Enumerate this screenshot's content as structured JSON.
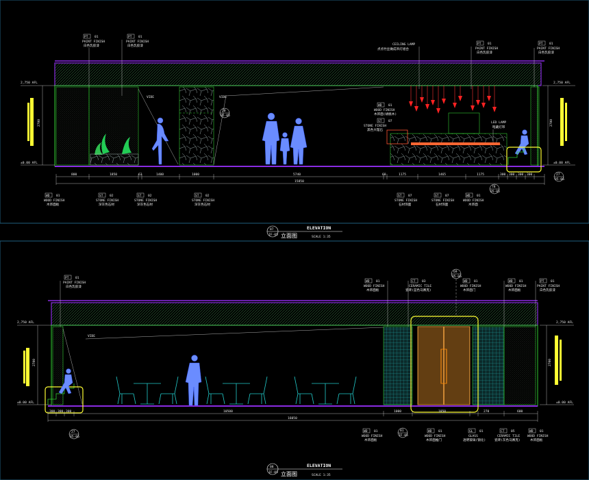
{
  "colors": {
    "background": "#000000",
    "ceiling_band": "#1a3a28",
    "purple_line": "#8a2be2",
    "green_line": "#33cc33",
    "cyan_line": "#22cccc",
    "yellow_line": "#ffff33",
    "red_lamp": "#ff2222",
    "human_figure": "#6699ff",
    "door_wood": "#cc8833"
  },
  "top": {
    "tags": {
      "pt_left1": {
        "code": "PT",
        "num": "01",
        "en": "PAINT FINISH",
        "cn": "白色乳胶漆"
      },
      "pt_left2": {
        "code": "PT",
        "num": "01",
        "en": "PAINT FINISH",
        "cn": "白色乳胶漆"
      },
      "ceiling_lamp": {
        "en": "CEILING LAMP",
        "cn": "点点竹丝做成吊灯组合"
      },
      "pt_right1": {
        "code": "PT",
        "num": "01",
        "en": "PAINT FINISH",
        "cn": "白色乳胶漆"
      },
      "pt_right2": {
        "code": "PT",
        "num": "01",
        "en": "PAINT FINISH",
        "cn": "白色乳胶漆"
      },
      "wd_mid": {
        "code": "WD",
        "num": "01",
        "en": "WOOD FINISH",
        "cn": "木饰面(胡桃木)"
      },
      "st_mid": {
        "code": "ST",
        "num": "07",
        "en": "STONE FINISH",
        "cn": "黑色大理石"
      },
      "led_lamp": {
        "en": "LED LAMP",
        "cn": "暗藏灯带"
      },
      "wd_bl": {
        "code": "WD",
        "num": "01",
        "en": "WOOD FINISH",
        "cn": "木饰面板"
      },
      "st_b1": {
        "code": "ST",
        "num": "02",
        "en": "STONE FINISH",
        "cn": "深灰色石材"
      },
      "st_b2": {
        "code": "ST",
        "num": "02",
        "en": "STONE FINISH",
        "cn": "深灰色石材"
      },
      "st_b3": {
        "code": "ST",
        "num": "02",
        "en": "STONE FINISH",
        "cn": "深灰色石材"
      },
      "st_br1": {
        "code": "ST",
        "num": "07",
        "en": "STONE FINISH",
        "cn": "石材饰面"
      },
      "st_br2": {
        "code": "ST",
        "num": "07",
        "en": "STONE FINISH",
        "cn": "石材饰面"
      },
      "wd_br3": {
        "code": "WD",
        "num": "01",
        "en": "WOOD FINISH",
        "cn": "木饰面"
      }
    },
    "void_label1": "VIDE",
    "void_label2": "VIDE",
    "bubble_20": {
      "num": "20",
      "ref": "05-05"
    },
    "bubble_78": {
      "num": "78",
      "ref": "05-05"
    },
    "bubble_27": {
      "num": "27",
      "ref": "05-06"
    },
    "levels": {
      "left_top": "2,750 AFL",
      "left_bot": "±0.00 AFL",
      "right_top": "2,750 AFL",
      "right_bot": "±0.00 AFL"
    },
    "height_left": "2700",
    "height_right": "2700",
    "dims": [
      "800",
      "1850",
      "63",
      "1400",
      "1000",
      "5740",
      "60",
      "1175",
      "1465",
      "1175",
      "300",
      "300",
      "300",
      "300"
    ],
    "total": "15850",
    "title_num": "07",
    "title_ref": "IF-05",
    "title_en": "ELEVATION",
    "title_cn": "立面图",
    "scale": "SCALE 1:35"
  },
  "bottom": {
    "tags": {
      "pt_left": {
        "code": "PT",
        "num": "01",
        "en": "PAINT FINISH",
        "cn": "白色乳胶漆"
      },
      "wd_a": {
        "code": "WD",
        "num": "01",
        "en": "WOOD FINISH",
        "cn": "木饰面板"
      },
      "ct_a": {
        "code": "CT",
        "num": "03",
        "en": "CERAMIC TILE",
        "cn": "瓷砖(蓝色马赛克)"
      },
      "wd_b": {
        "code": "WD",
        "num": "01",
        "en": "WOOD FINISH",
        "cn": "木饰面门"
      },
      "wd_c": {
        "code": "WD",
        "num": "01",
        "en": "WOOD FINISH",
        "cn": "木饰面板"
      },
      "pt_right": {
        "code": "PT",
        "num": "01",
        "en": "PAINT FINISH",
        "cn": "白色乳胶漆"
      },
      "wd_bl": {
        "code": "WD",
        "num": "01",
        "en": "WOOD FINISH",
        "cn": "木饰面板"
      },
      "wd_b2": {
        "code": "WD",
        "num": "01",
        "en": "WOOD FINISH",
        "cn": "木饰面推门"
      },
      "gl": {
        "code": "GL",
        "num": "01",
        "en": "GLASS",
        "cn": "透明玻璃(钢化)"
      },
      "ct_b": {
        "code": "CT",
        "num": "05",
        "en": "CERAMIC TILE",
        "cn": "瓷砖(灰色马赛克)"
      },
      "wd_b3": {
        "code": "WD",
        "num": "01",
        "en": "WOOD FINISH",
        "cn": "木饰面板"
      }
    },
    "void_label": "VIDE",
    "bubble_69": {
      "num": "69",
      "ref": "05-06"
    },
    "bubble_27": {
      "num": "27",
      "ref": "05-06"
    },
    "bubble_01": {
      "num": "01",
      "ref": "IF-05"
    },
    "levels": {
      "left_top": "2,750 AFL",
      "left_bot": "±0.00 AFL",
      "right_top": "2,750 AFL",
      "right_bot": "±0.00 AFL"
    },
    "height_left": "2700",
    "height_right": "2700",
    "dims": [
      "300",
      "300",
      "300",
      "10500",
      "1000",
      "1850",
      "270",
      "600"
    ],
    "total": "16050",
    "title_num": "08",
    "title_ref": "IF-05",
    "title_en": "ELEVATION",
    "title_cn": "立面图",
    "scale": "SCALE 1:35"
  }
}
